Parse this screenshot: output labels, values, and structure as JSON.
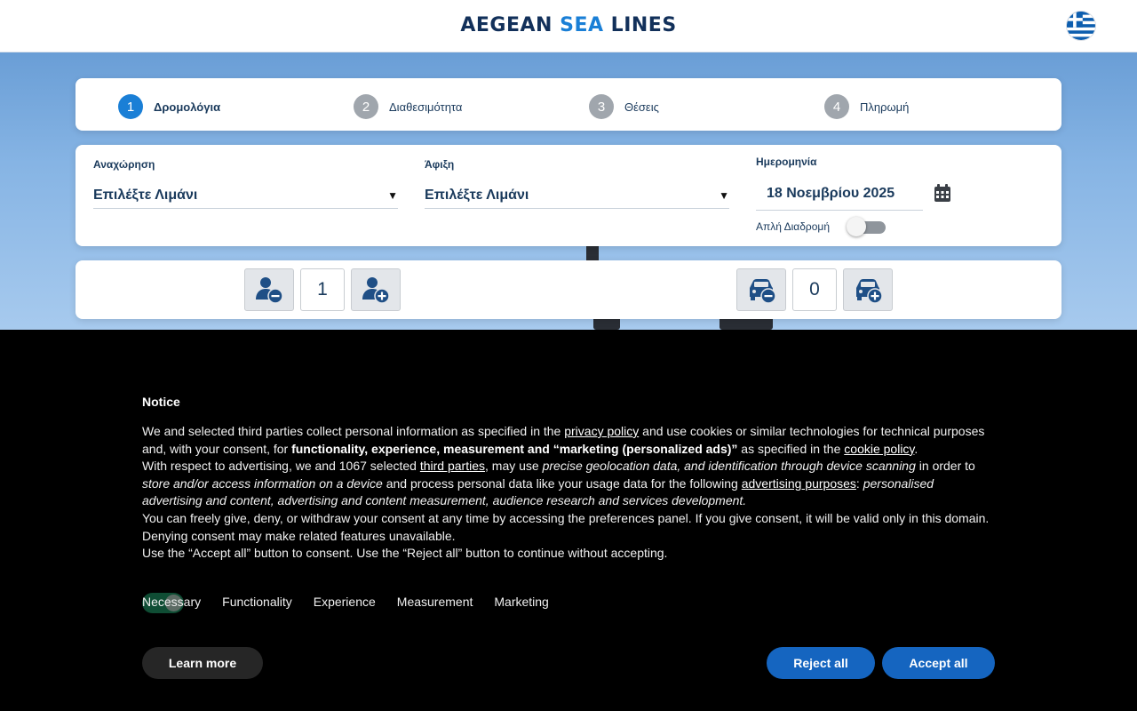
{
  "header": {
    "logo": {
      "part1": "AEGEAN",
      "part2": "SEA",
      "part3": "LINES"
    },
    "language_flag": "greece-flag-icon"
  },
  "steps": [
    {
      "num": "1",
      "label": "Δρομολόγια",
      "active": true
    },
    {
      "num": "2",
      "label": "Διαθεσιμότητα",
      "active": false
    },
    {
      "num": "3",
      "label": "Θέσεις",
      "active": false
    },
    {
      "num": "4",
      "label": "Πληρωμή",
      "active": false
    }
  ],
  "search": {
    "departure": {
      "label": "Αναχώρηση",
      "value": "Επιλέξτε Λιμάνι"
    },
    "arrival": {
      "label": "Άφιξη",
      "value": "Επιλέξτε Λιμάνι"
    },
    "date": {
      "label": "Ημερομηνία",
      "value": "18 Νοεμβρίου 2025"
    },
    "one_way": {
      "label": "Απλή Διαδρομή",
      "on": false
    },
    "arrow": "▼"
  },
  "counts": {
    "passengers": "1",
    "vehicles": "0"
  },
  "consent": {
    "title": "Notice",
    "p1a": "We and selected third parties collect personal information as specified in the ",
    "privacy_link": "privacy policy",
    "p1b": " and use cookies or similar technologies for technical purposes and, with your consent, for ",
    "p1bold": "functionality, experience, measurement and “marketing (personalized ads)”",
    "p1c": " as specified in the ",
    "cookie_link": "cookie policy",
    "p1d": ".",
    "p2a": "With respect to advertising, we and 1067 selected ",
    "third_parties_link": "third parties",
    "p2b": ", may use ",
    "p2i1": "precise geolocation data, and identification through device scanning",
    "p2c": " in order to ",
    "p2i2": "store and/or access information on a device",
    "p2d": " and process personal data like your usage data for the following ",
    "adv_link": "advertising purposes",
    "p2e": ": ",
    "p2i3": "personalised advertising and content, advertising and content measurement, audience research and services development.",
    "p3": "You can freely give, deny, or withdraw your consent at any time by accessing the preferences panel. If you give consent, it will be valid only in this domain. Denying consent may make related features unavailable.",
    "p4": "Use the “Accept all” button to consent. Use the “Reject all” button to continue without accepting.",
    "categories": [
      "Necessary",
      "Functionality",
      "Experience",
      "Measurement",
      "Marketing"
    ],
    "learn_more": "Learn more",
    "reject_all": "Reject all",
    "accept_all": "Accept all"
  },
  "colors": {
    "brand_navy": "#12305a",
    "brand_blue": "#1a7fd6",
    "button_blue": "#1565c0"
  }
}
